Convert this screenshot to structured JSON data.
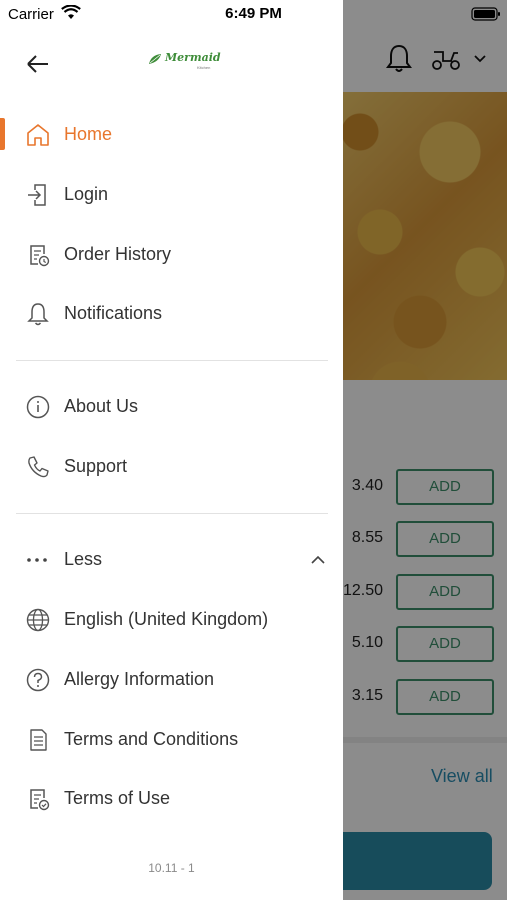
{
  "status_bar": {
    "carrier": "Carrier",
    "time": "6:49 PM"
  },
  "drawer": {
    "logo_text": "Mermaid",
    "logo_sub": "Kitchen",
    "menu_primary": [
      {
        "label": "Home",
        "icon": "home-icon",
        "active": true
      },
      {
        "label": "Login",
        "icon": "login-icon"
      },
      {
        "label": "Order History",
        "icon": "order-history-icon"
      },
      {
        "label": "Notifications",
        "icon": "bell-icon"
      }
    ],
    "menu_secondary": [
      {
        "label": "About Us",
        "icon": "info-icon"
      },
      {
        "label": "Support",
        "icon": "phone-icon"
      }
    ],
    "less_label": "Less",
    "menu_more": [
      {
        "label": "English (United Kingdom)",
        "icon": "globe-icon"
      },
      {
        "label": "Allergy Information",
        "icon": "question-icon"
      },
      {
        "label": "Terms and Conditions",
        "icon": "document-icon"
      },
      {
        "label": "Terms of Use",
        "icon": "document-check-icon"
      }
    ],
    "version": "10.11 - 1"
  },
  "background": {
    "items": [
      {
        "price": "3.40",
        "add_label": "ADD"
      },
      {
        "price": "8.55",
        "add_label": "ADD"
      },
      {
        "price": "12.50",
        "add_label": "ADD"
      },
      {
        "price": "5.10",
        "add_label": "ADD"
      },
      {
        "price": "3.15",
        "add_label": "ADD"
      }
    ],
    "view_all": "View all"
  },
  "colors": {
    "accent": "#e8762d",
    "green": "#3d8f6a",
    "link": "#2b8db3",
    "teal_button": "#2a8aa6"
  }
}
